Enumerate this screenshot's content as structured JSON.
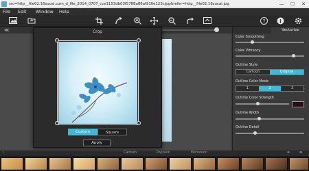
{
  "window": {
    "title": "src=http__file02.16sucai.com_d_file_2014_0707_cce1153db03f5788a86af910e123cjpg&refer=http__file02.16sucai.jpg",
    "controls": [
      "—",
      "☐",
      "✕"
    ]
  },
  "menu": {
    "items": [
      "File",
      "Edit",
      "Window",
      "Help"
    ]
  },
  "toolbar": {
    "icons": [
      "image-icon",
      "open-icon",
      "crop-icon",
      "straighten-icon",
      "zoom-in-icon",
      "move-icon",
      "zoom-out-icon",
      "redo-icon",
      "export-icon",
      "help-icon",
      "info-icon",
      "settings-icon"
    ]
  },
  "crop_dialog": {
    "title": "Crop",
    "mode_options": [
      "Custom",
      "Square"
    ],
    "active_mode": "Custom",
    "apply_label": "Apply"
  },
  "panel": {
    "tab_label": "Vectorize",
    "color_smoothing_label": "Color Smoothing",
    "color_smoothing_level": 0.25,
    "color_vibrancy_label": "Color Vibrancy",
    "color_vibrancy_level": 0.85,
    "outline_style_label": "Outline Style",
    "outline_style_options": [
      "Cartoon",
      "Original"
    ],
    "outline_style_active": "Original",
    "outline_color_mode_label": "Outline Color Mode",
    "outline_color_mode_options": [
      "1",
      "2",
      "3"
    ],
    "outline_color_mode_active": "2",
    "outline_color_strength_label": "Outline Color Strength",
    "outline_color_strength_level": 0.4,
    "outline_color_swatch": "#2a0d1b",
    "outline_width_label": "Outline Width",
    "outline_width_level": 0.35,
    "outline_detail_label": "Outline Detail",
    "outline_detail_level": 0.3
  },
  "filmstrip": {
    "categories": [
      "Cartoon",
      "Poptoon",
      "Monotoon"
    ],
    "thumb_count": 13
  },
  "colors": {
    "accent": "#3fb9d6",
    "background": "#3d3d3d",
    "panel": "#3a3a3a"
  }
}
